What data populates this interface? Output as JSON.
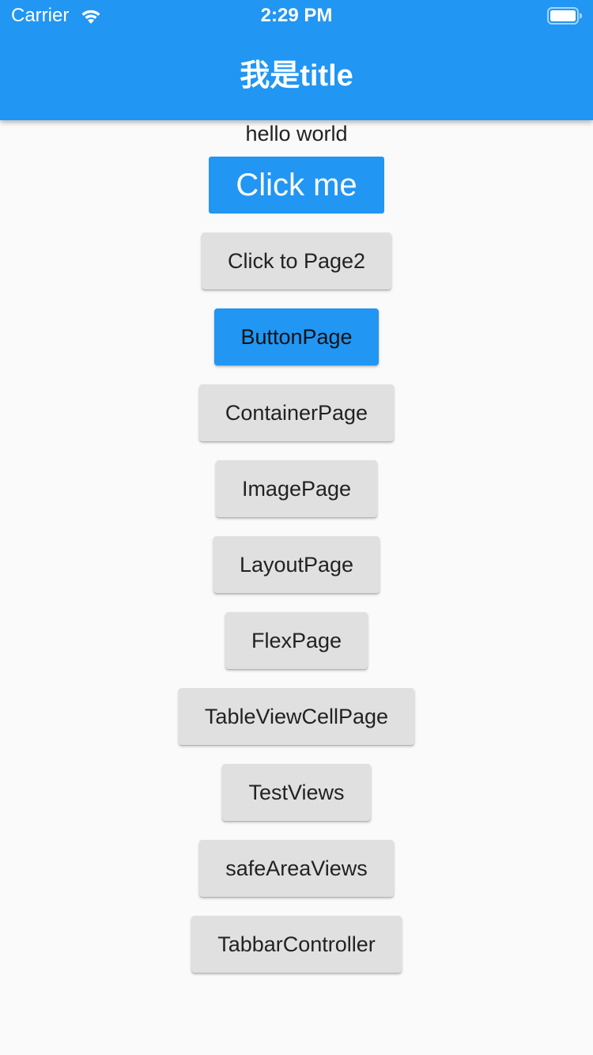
{
  "status_bar": {
    "carrier": "Carrier",
    "time": "2:29 PM",
    "wifi_icon": "wifi-icon",
    "battery_icon": "battery-icon"
  },
  "app_bar": {
    "title": "我是title",
    "color": "#2196f3"
  },
  "content": {
    "hello_text": "hello world",
    "click_me_label": "Click me",
    "buttons": [
      {
        "label": "Click to Page2",
        "color": "#e0e0e0"
      },
      {
        "label": "ButtonPage",
        "color": "#2196f3"
      },
      {
        "label": "ContainerPage",
        "color": "#e0e0e0"
      },
      {
        "label": "ImagePage",
        "color": "#e0e0e0"
      },
      {
        "label": "LayoutPage",
        "color": "#e0e0e0"
      },
      {
        "label": "FlexPage",
        "color": "#e0e0e0"
      },
      {
        "label": "TableViewCellPage",
        "color": "#e0e0e0"
      },
      {
        "label": "TestViews",
        "color": "#e0e0e0"
      },
      {
        "label": "safeAreaViews",
        "color": "#e0e0e0"
      },
      {
        "label": "TabbarController",
        "color": "#e0e0e0"
      }
    ]
  }
}
